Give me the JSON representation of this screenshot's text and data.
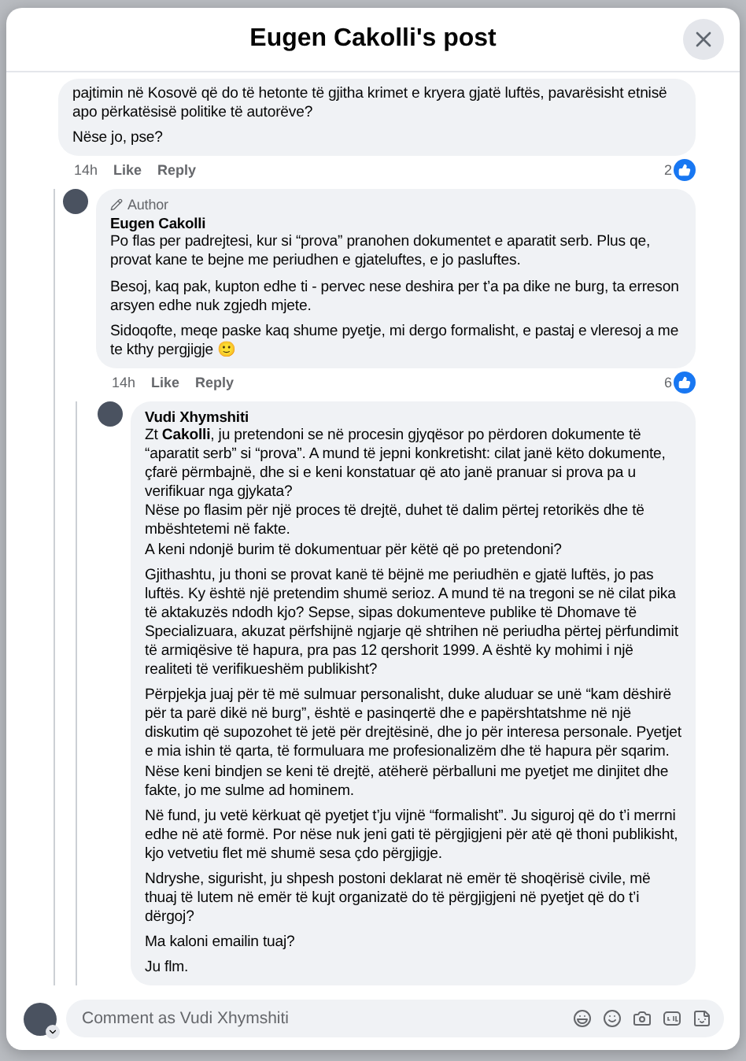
{
  "dialog": {
    "title": "Eugen Cakolli's post"
  },
  "comments": [
    {
      "paragraphs": [
        "pajtimin në Kosovë që do të hetonte të gjitha krimet e kryera gjatë luftës, pavarësisht etnisë apo përkatësisë politike të autorëve?",
        "Nëse jo, pse?"
      ],
      "time": "14h",
      "actions": [
        "Like",
        "Reply"
      ],
      "reactions": "2",
      "children": [
        {
          "author": "Eugen Cakolli",
          "badge": "Author",
          "paragraphs": [
            "Po flas per padrejtesi, kur si “prova” pranohen dokumentet e aparatit serb. Plus qe, provat kane te bejne me periudhen e gjateluftes, e jo pasluftes.",
            "Besoj, kaq pak, kupton edhe ti - pervec nese deshira per t’a pa dike ne burg, ta erreson arsyen edhe nuk zgjedh mjete.",
            "Sidoqofte, meqe paske kaq shume pyetje, mi dergo formalisht, e pastaj e vleresoj a me te kthy pergjigje 🙂"
          ],
          "time": "14h",
          "actions": [
            "Like",
            "Reply"
          ],
          "reactions": "6",
          "children": [
            {
              "author": "Vudi Xhymshiti",
              "paragraphs": [
                "Zt **Cakolli**, ju pretendoni se në procesin gjyqësor po përdoren dokumente të “aparatit serb” si “prova”. A mund të jepni konkretisht: cilat janë këto dokumente, çfarë përmbajnë, dhe si e keni konstatuar që ato janë pranuar si prova pa u verifikuar nga gjykata?\nNëse po flasim për një proces të drejtë, duhet të dalim përtej retorikës dhe të mbështetemi në fakte.\nA keni ndonjë burim të dokumentuar për këtë që po pretendoni?",
                "Gjithashtu, ju thoni se provat kanë të bëjnë me periudhën e gjatë luftës, jo pas luftës. Ky është një pretendim shumë serioz. A mund të na tregoni se në cilat pika të aktakuzës ndodh kjo? Sepse, sipas dokumenteve publike të Dhomave të Specializuara, akuzat përfshijnë ngjarje që shtrihen në periudha përtej përfundimit të armiqësive të hapura, pra pas 12 qershorit 1999. A është ky mohimi i një realiteti të verifikueshëm publikisht?",
                "Përpjekja juaj për të më sulmuar personalisht, duke aluduar se unë “kam dëshirë për ta parë dikë në burg”, është e pasinqertë dhe e papërshtatshme në një diskutim që supozohet të jetë për drejtësinë, dhe jo për interesa personale. Pyetjet e mia ishin të qarta, të formuluara me profesionalizëm dhe të hapura për sqarim. Nëse keni bindjen se keni të drejtë, atëherë përballuni me pyetjet me dinjitet dhe fakte, jo me sulme ad hominem.",
                "Në fund, ju vetë kërkuat që pyetjet t’ju vijnë “formalisht”. Ju siguroj që do t’i merrni edhe në atë formë. Por nëse nuk jeni gati të përgjigjeni për atë që thoni publikisht, kjo vetvetiu flet më shumë sesa çdo përgjigje.",
                "Ndryshe, sigurisht, ju shpesh postoni deklarat në emër të shoqërisë civile, më thuaj të lutem në emër të kujt organizatë do të përgjigjeni në pyetjet që do t’i dërgoj?",
                "Ma kaloni emailin tuaj?",
                "Ju flm."
              ]
            }
          ]
        }
      ]
    }
  ],
  "composer": {
    "placeholder": "Comment as Vudi Xhymshiti"
  }
}
